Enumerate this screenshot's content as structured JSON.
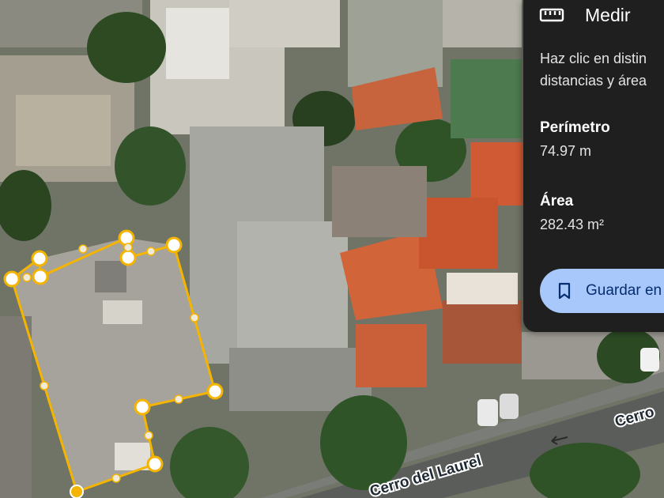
{
  "map": {
    "streets": [
      {
        "name": "Cerro del Laurel"
      },
      {
        "name": "Cerro"
      }
    ]
  },
  "measure_panel": {
    "title": "Medir",
    "title_icon": "ruler-icon",
    "description_line1": "Haz clic en distin",
    "description_line2": "distancias y área",
    "perimeter_label": "Perímetro",
    "perimeter_value": "74.97 m",
    "area_label": "Área",
    "area_value": "282.43 m²",
    "save_label": "Guardar en",
    "save_icon": "bookmark-icon"
  },
  "colors": {
    "measure_line": "#f4b400",
    "panel_bg": "#1f1f1f",
    "button_bg": "#a8c7fa",
    "button_text": "#062e6f"
  }
}
